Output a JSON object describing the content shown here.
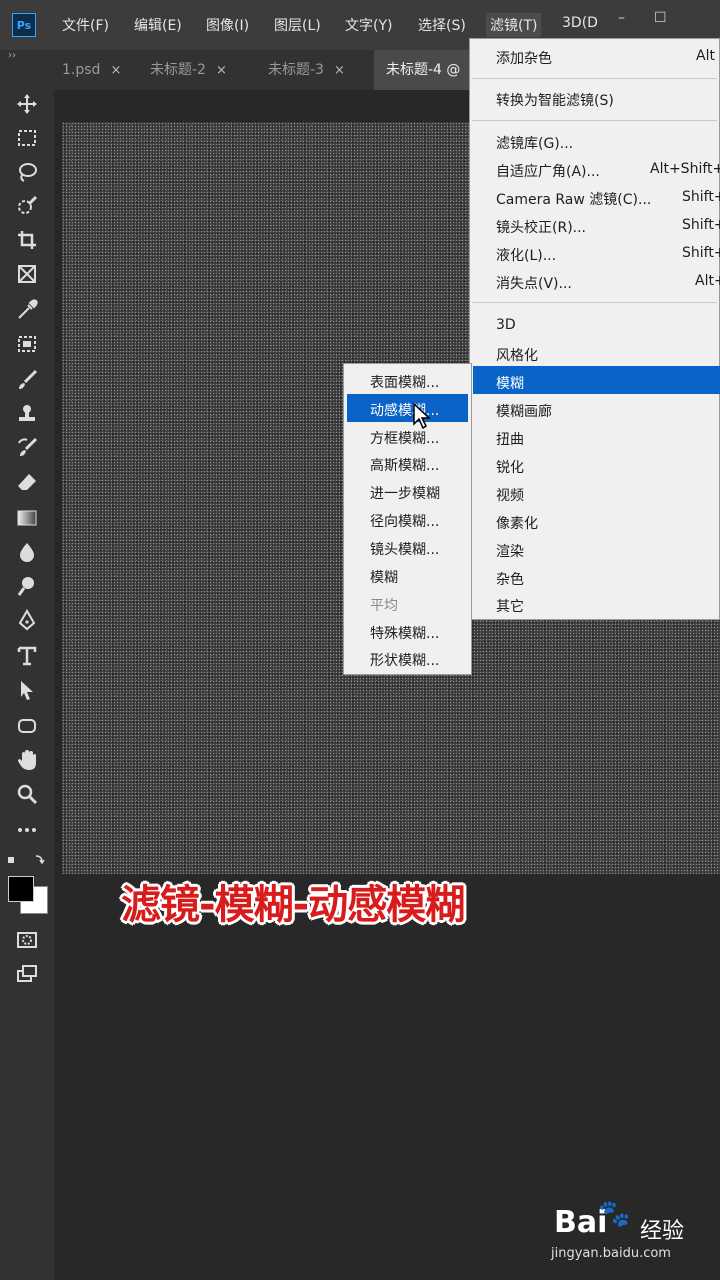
{
  "app": {
    "logo": "Ps"
  },
  "menubar": {
    "items": [
      "文件(F)",
      "编辑(E)",
      "图像(I)",
      "图层(L)",
      "文字(Y)",
      "选择(S)",
      "滤镜(T)",
      "3D(D"
    ],
    "active_index": 6,
    "window_controls": [
      "–",
      "☐"
    ]
  },
  "tabs": {
    "collapse": "››",
    "items": [
      {
        "label": "1.psd",
        "close": "×"
      },
      {
        "label": "未标题-2",
        "close": "×"
      },
      {
        "label": "未标题-3",
        "close": "×"
      },
      {
        "label": "未标题-4 @",
        "close": ""
      }
    ]
  },
  "filter_menu": {
    "items": [
      {
        "label": "添加杂色",
        "shortcut": "Alt"
      },
      {
        "label": "转换为智能滤镜(S)",
        "shortcut": ""
      },
      {
        "label": "滤镜库(G)...",
        "shortcut": ""
      },
      {
        "label": "自适应广角(A)...",
        "shortcut": "Alt+Shift+"
      },
      {
        "label": "Camera Raw 滤镜(C)...",
        "shortcut": "Shift+"
      },
      {
        "label": "镜头校正(R)...",
        "shortcut": "Shift+"
      },
      {
        "label": "液化(L)...",
        "shortcut": "Shift+"
      },
      {
        "label": "消失点(V)...",
        "shortcut": "Alt+"
      },
      {
        "label": "3D",
        "shortcut": ""
      },
      {
        "label": "风格化",
        "shortcut": ""
      },
      {
        "label": "模糊",
        "shortcut": "",
        "highlighted": true
      },
      {
        "label": "模糊画廊",
        "shortcut": ""
      },
      {
        "label": "扭曲",
        "shortcut": ""
      },
      {
        "label": "锐化",
        "shortcut": ""
      },
      {
        "label": "视频",
        "shortcut": ""
      },
      {
        "label": "像素化",
        "shortcut": ""
      },
      {
        "label": "渲染",
        "shortcut": ""
      },
      {
        "label": "杂色",
        "shortcut": ""
      },
      {
        "label": "其它",
        "shortcut": ""
      }
    ]
  },
  "blur_menu": {
    "items": [
      {
        "label": "表面模糊..."
      },
      {
        "label": "动感模糊...",
        "highlighted": true
      },
      {
        "label": "方框模糊..."
      },
      {
        "label": "高斯模糊..."
      },
      {
        "label": "进一步模糊"
      },
      {
        "label": "径向模糊..."
      },
      {
        "label": "镜头模糊..."
      },
      {
        "label": "模糊"
      },
      {
        "label": "平均",
        "disabled": true
      },
      {
        "label": "特殊模糊..."
      },
      {
        "label": "形状模糊..."
      }
    ]
  },
  "caption": "滤镜-模糊-动感模糊",
  "watermark": {
    "logo": "Bai",
    "paw": "🐾",
    "cn": "经验",
    "url": "jingyan.baidu.com"
  },
  "toolbar_icons": [
    "move-icon",
    "marquee-icon",
    "lasso-icon",
    "quick-select-icon",
    "crop-icon",
    "frame-icon",
    "eyedropper-icon",
    "healing-icon",
    "brush-icon",
    "stamp-icon",
    "history-brush-icon",
    "eraser-icon",
    "gradient-icon",
    "blur-tool-icon",
    "dodge-icon",
    "pen-icon",
    "type-icon",
    "path-select-icon",
    "shape-icon",
    "hand-icon",
    "zoom-icon",
    "more-icon"
  ]
}
